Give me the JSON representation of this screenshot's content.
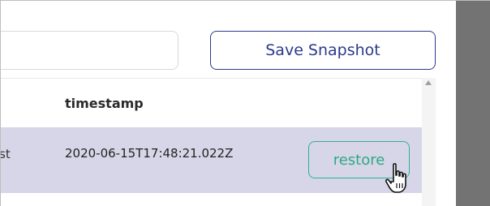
{
  "toolbar": {
    "name_input_value": "",
    "save_label": "Save Snapshot"
  },
  "table": {
    "columns": [
      "timestamp"
    ],
    "rows": [
      {
        "name_fragment": "st",
        "timestamp": "2020-06-15T17:48:21.022Z",
        "action_label": "restore",
        "highlighted": true
      }
    ]
  },
  "colors": {
    "save_accent": "#2b3a8c",
    "restore_accent": "#2fb08f",
    "row_highlight": "#d6d6e8",
    "backdrop": "#737373"
  },
  "icons": {
    "cursor": "hand-pointer-icon",
    "scroll_up": "scroll-up-arrow-icon"
  }
}
